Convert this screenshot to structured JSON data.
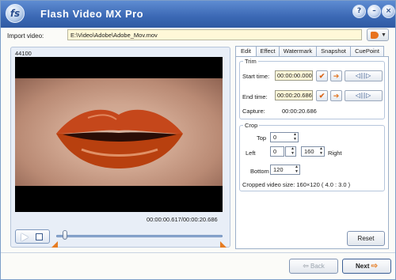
{
  "window": {
    "title": "Flash Video MX Pro",
    "logo_text": "fs"
  },
  "titlebar_buttons": {
    "help": "?",
    "minimize": "–",
    "close": "×"
  },
  "import": {
    "label": "Import video:",
    "path": "E:\\Video\\Adobe\\Adobe_Mov.mov"
  },
  "video": {
    "frame_count": "44100",
    "time": "00:00:00.617/00:00:20.686",
    "seek_position": 0.03
  },
  "tabs": [
    "Edit",
    "Effect",
    "Watermark",
    "Snapshot",
    "CuePoint"
  ],
  "trim": {
    "legend": "Trim",
    "start_label": "Start time:",
    "start_value": "00:00:00.000",
    "end_label": "End time:",
    "end_value": "00:00:20.686",
    "capture_label": "Capture:",
    "capture_value": "00:00:20.686"
  },
  "crop": {
    "legend": "Crop",
    "top_label": "Top",
    "top_value": "0",
    "left_label": "Left",
    "left_value": "0",
    "right_label": "Right",
    "right_value": "160",
    "bottom_label": "Bottom",
    "bottom_value": "120",
    "size_text": "Cropped video size: 160×120  ( 4.0 : 3.0 )"
  },
  "buttons": {
    "reset": "Reset",
    "back": "Back",
    "next": "Next"
  },
  "colors": {
    "accent": "#e67c22",
    "title_bar": "#3b68b4",
    "field_bg": "#fff8d8"
  }
}
